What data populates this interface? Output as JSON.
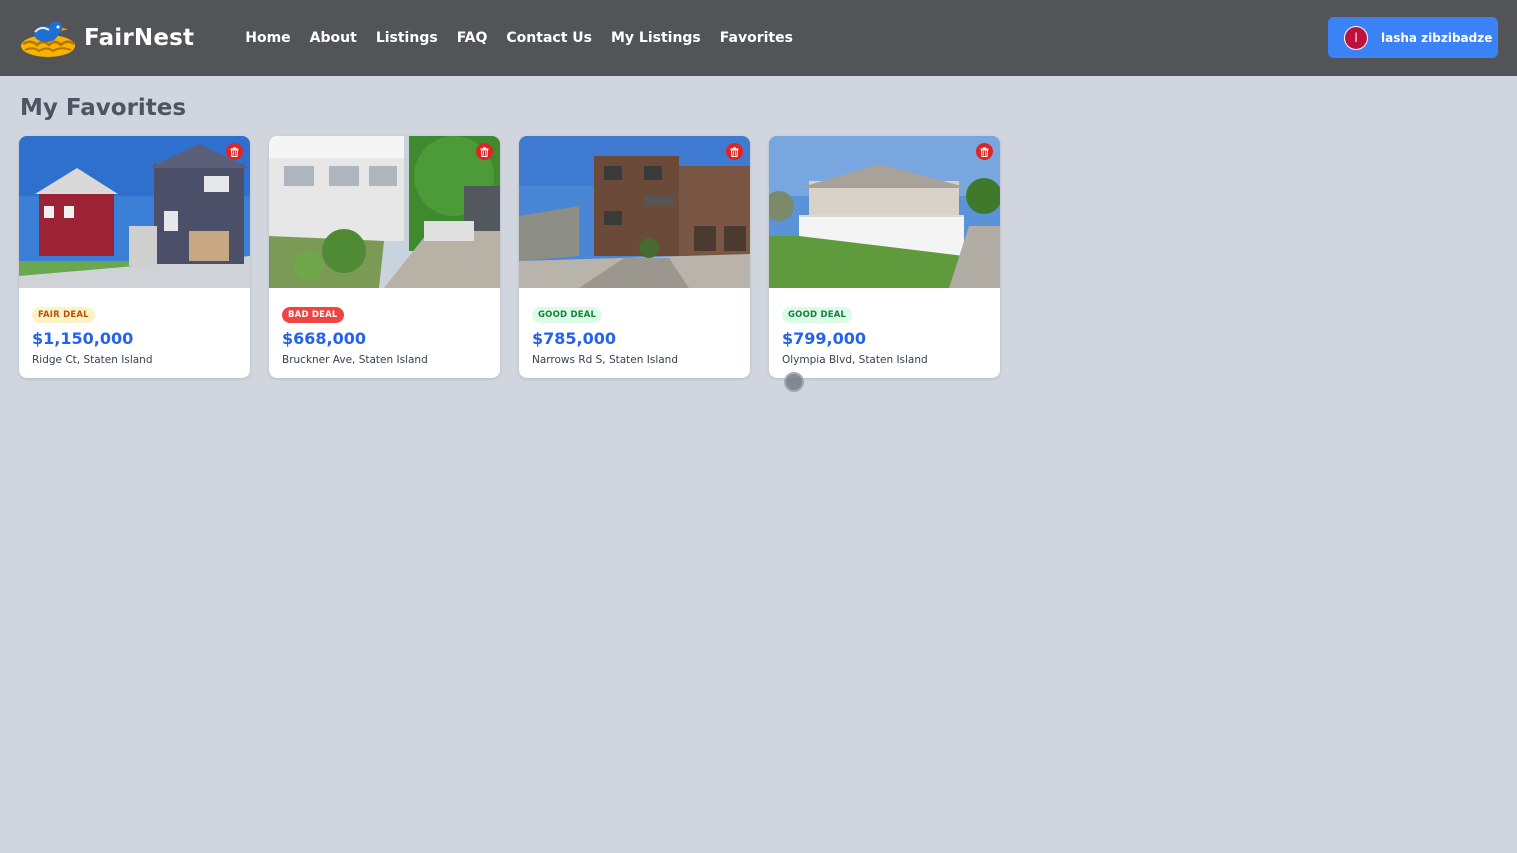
{
  "navbar": {
    "brand": "FairNest",
    "links": [
      "Home",
      "About",
      "Listings",
      "FAQ",
      "Contact Us",
      "My Listings",
      "Favorites"
    ],
    "user": {
      "initial": "l",
      "name": "lasha zibzibadze"
    }
  },
  "page": {
    "title": "My Favorites"
  },
  "favorites": [
    {
      "badge": "FAIR DEAL",
      "price": "$1,150,000",
      "address": "Ridge Ct, Staten Island",
      "icon": "trash-icon"
    },
    {
      "badge": "BAD DEAL",
      "price": "$668,000",
      "address": "Bruckner Ave, Staten Island",
      "icon": "trash-icon"
    },
    {
      "badge": "GOOD DEAL",
      "price": "$785,000",
      "address": "Narrows Rd S, Staten Island",
      "icon": "trash-icon"
    },
    {
      "badge": "GOOD DEAL",
      "price": "$799,000",
      "address": "Olympia Blvd, Staten Island",
      "icon": "trash-icon"
    }
  ],
  "colors": {
    "navbar": "#525458",
    "accent": "#3b82f6",
    "price": "#2563eb",
    "delete": "#dc2626",
    "fair": "#fef3c7",
    "bad": "#ef4444",
    "good": "#dcfce7"
  }
}
